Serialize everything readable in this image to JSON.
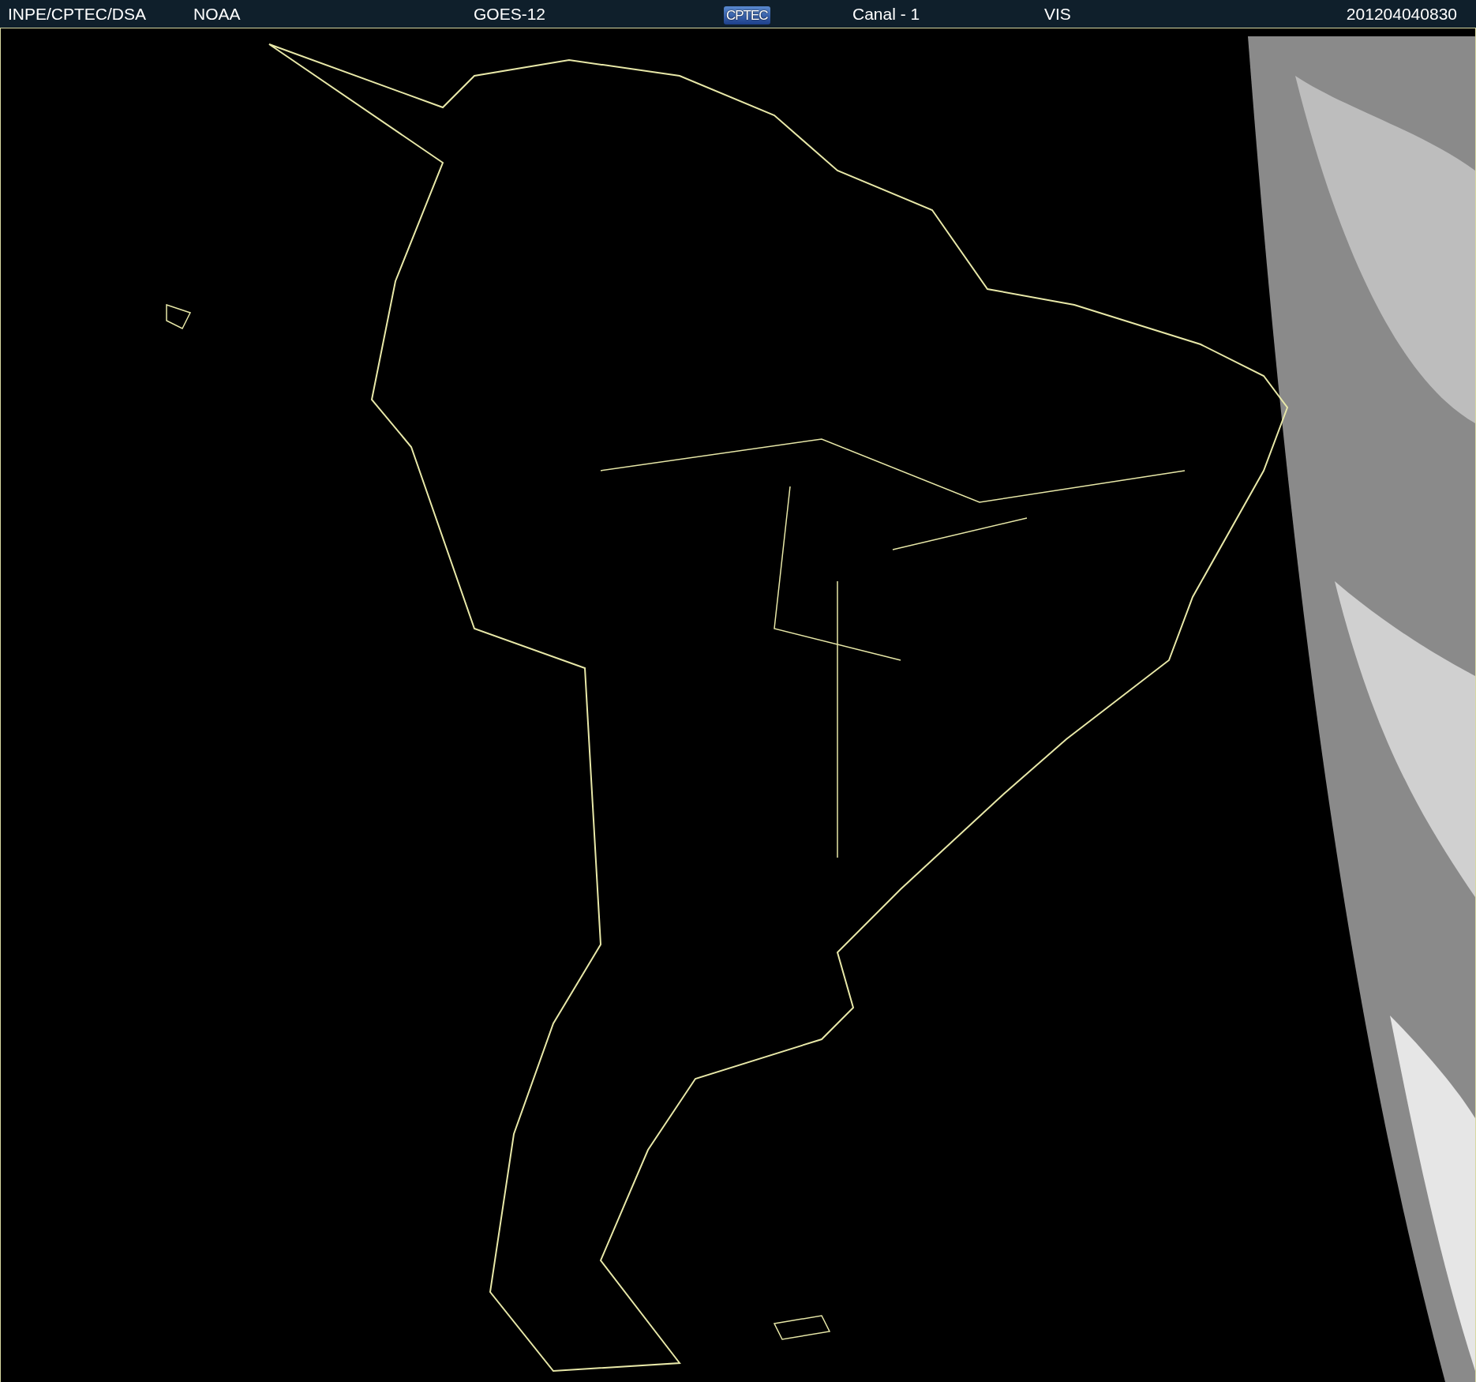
{
  "header": {
    "items": [
      {
        "kind": "text",
        "text": "INPE/CPTEC/DSA"
      },
      {
        "kind": "text",
        "text": "NOAA"
      },
      {
        "kind": "text",
        "text": "GOES-12"
      },
      {
        "kind": "logo",
        "text": "CPTEC"
      },
      {
        "kind": "text",
        "text": "Canal - 1"
      },
      {
        "kind": "text",
        "text": "VIS"
      },
      {
        "kind": "text",
        "text": "201204040830"
      }
    ]
  }
}
